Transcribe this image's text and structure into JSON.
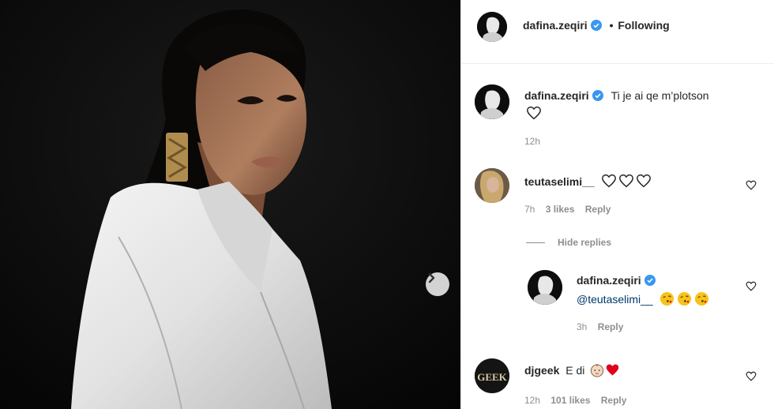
{
  "header": {
    "username": "dafina.zeqiri",
    "separator": "•",
    "follow_status": "Following"
  },
  "caption": {
    "username": "dafina.zeqiri",
    "text": "Ti je ai qe m’plotson",
    "time": "12h"
  },
  "comments": [
    {
      "username": "teutaselimi__",
      "time": "7h",
      "likes": "3 likes",
      "reply_label": "Reply"
    },
    {
      "username": "dafina.zeqiri",
      "mention": "@teutaselimi__",
      "time": "3h",
      "reply_label": "Reply"
    },
    {
      "username": "djgeek",
      "text": "E di",
      "avatar_text": "GEEK",
      "time": "12h",
      "likes": "101 likes",
      "reply_label": "Reply"
    }
  ],
  "hide_replies_label": "Hide replies",
  "colors": {
    "verified_badge": "#3897f0",
    "text_primary": "#262626",
    "text_secondary": "#8e8e8e",
    "mention": "#00376b",
    "red_heart": "#e0001b"
  }
}
